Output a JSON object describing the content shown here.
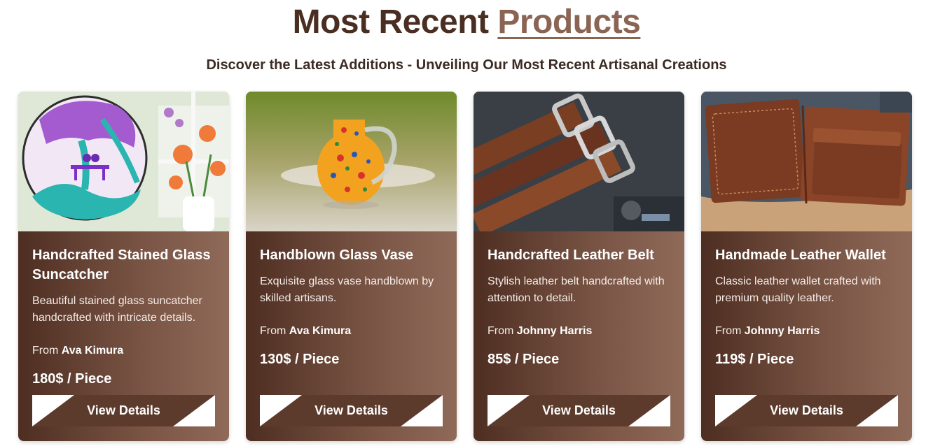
{
  "header": {
    "title_main": "Most Recent",
    "title_accent": "Products",
    "subtitle": "Discover the Latest Additions - Unveiling Our Most Recent Artisanal Creations"
  },
  "products": [
    {
      "title": "Handcrafted Stained Glass Suncatcher",
      "description": "Beautiful stained glass suncatcher handcrafted with intricate details.",
      "from_label": "From",
      "artisan": "Ava Kimura",
      "price": "180$ / Piece",
      "button": "View Details",
      "image": "stained-glass-suncatcher-image"
    },
    {
      "title": "Handblown Glass Vase",
      "description": "Exquisite glass vase handblown by skilled artisans.",
      "from_label": "From",
      "artisan": "Ava Kimura",
      "price": "130$ / Piece",
      "button": "View Details",
      "image": "glass-vase-image"
    },
    {
      "title": "Handcrafted Leather Belt",
      "description": "Stylish leather belt handcrafted with attention to detail.",
      "from_label": "From",
      "artisan": "Johnny Harris",
      "price": "85$ / Piece",
      "button": "View Details",
      "image": "leather-belt-image"
    },
    {
      "title": "Handmade Leather Wallet",
      "description": "Classic leather wallet crafted with premium quality leather.",
      "from_label": "From",
      "artisan": "Johnny Harris",
      "price": "119$ / Piece",
      "button": "View Details",
      "image": "leather-wallet-image"
    }
  ],
  "colors": {
    "brand_dark": "#4a2e22",
    "brand_accent": "#8b6553",
    "card_gradient_start": "#4e2e22",
    "card_gradient_end": "#8f6a59"
  }
}
